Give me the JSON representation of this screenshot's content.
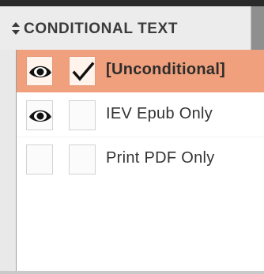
{
  "panel": {
    "title": "CONDITIONAL TEXT",
    "toggle_icon": "up-down-arrows-icon"
  },
  "conditions": [
    {
      "label": "[Unconditional]",
      "visible": true,
      "checked": true,
      "selected": true
    },
    {
      "label": "IEV Epub Only",
      "visible": true,
      "checked": false,
      "selected": false
    },
    {
      "label": "Print PDF Only",
      "visible": false,
      "checked": false,
      "selected": false
    }
  ],
  "colors": {
    "selection": "#f0a07c",
    "panel_background": "#ececec",
    "list_background": "#ffffff"
  }
}
